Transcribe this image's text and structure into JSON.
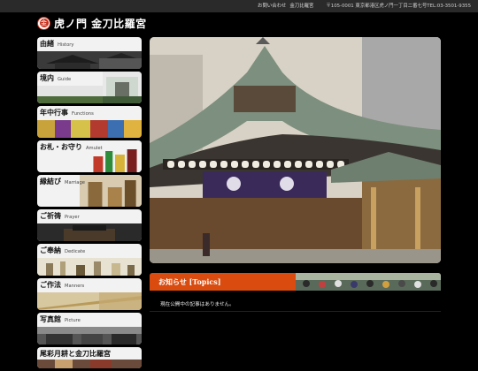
{
  "top_nav": {
    "links": [
      "お問い合わせ",
      "金刀比羅宮"
    ],
    "address": "〒105-0001 東京都港区虎ノ門一丁目二番七号TEL:03-3501-9355"
  },
  "logo": {
    "mark": "金",
    "text": "虎ノ門 金刀比羅宮"
  },
  "sidebar": {
    "items": [
      {
        "jp": "由緒",
        "en": "History"
      },
      {
        "jp": "境内",
        "en": "Guide"
      },
      {
        "jp": "年中行事",
        "en": "Functions"
      },
      {
        "jp": "お札・お守り",
        "en": "Amulet"
      },
      {
        "jp": "縁結び",
        "en": "Marriage"
      },
      {
        "jp": "ご祈祷",
        "en": "Prayer"
      },
      {
        "jp": "ご奉納",
        "en": "Dedicate"
      },
      {
        "jp": "ご作法",
        "en": "Manners"
      },
      {
        "jp": "写真館",
        "en": "Picture"
      },
      {
        "jp": "尾彩月耕と金刀比羅宮",
        "en": ""
      }
    ]
  },
  "news": {
    "title": "お知らせ [Topics]",
    "message": "現在公開中の記事はありません。"
  },
  "colors": {
    "accent": "#d94b0f",
    "logo_red": "#c7301c",
    "background": "#000000"
  }
}
